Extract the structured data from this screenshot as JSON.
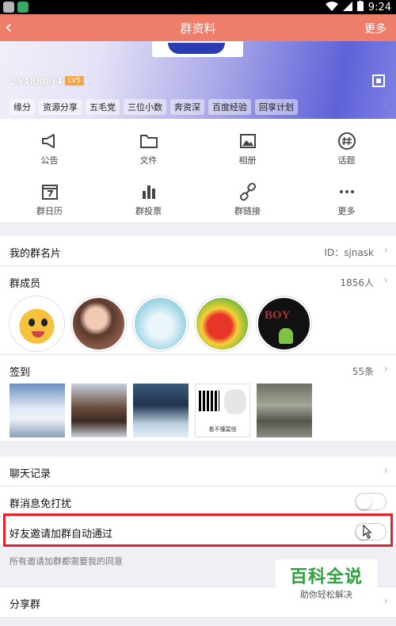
{
  "statusbar": {
    "time": "9:24"
  },
  "navbar": {
    "back": "‹",
    "title": "群资料",
    "more": "更多"
  },
  "header": {
    "group_id": "254880947",
    "level": "LV5",
    "tags": [
      "缘分",
      "资源分享",
      "五毛党",
      "三位小数",
      "奔资深",
      "百度经验",
      "回享计划"
    ]
  },
  "features": [
    {
      "label": "公告",
      "icon": "megaphone-icon"
    },
    {
      "label": "文件",
      "icon": "folder-icon"
    },
    {
      "label": "相册",
      "icon": "photo-album-icon"
    },
    {
      "label": "话题",
      "icon": "hashtag-icon"
    },
    {
      "label": "群日历",
      "icon": "calendar-icon"
    },
    {
      "label": "群投票",
      "icon": "bar-chart-icon"
    },
    {
      "label": "群链接",
      "icon": "link-icon"
    },
    {
      "label": "更多",
      "icon": "more-dots-icon"
    }
  ],
  "card": {
    "my_name_label": "我的群名片",
    "my_name_value": "ID：sjnask",
    "members_label": "群成员",
    "members_count": "1856人",
    "checkin_label": "签到",
    "checkin_count": "55条",
    "checkin_qr_caption": "看不懂莫怪"
  },
  "settings": {
    "chat_history": "聊天记录",
    "mute": "群消息免打扰",
    "auto_accept": "好友邀请加群自动通过",
    "note": "所有邀请加群都需要我的同意",
    "share": "分享群"
  },
  "watermark": {
    "title": "百科全说",
    "subtitle": "助你轻松解决"
  }
}
